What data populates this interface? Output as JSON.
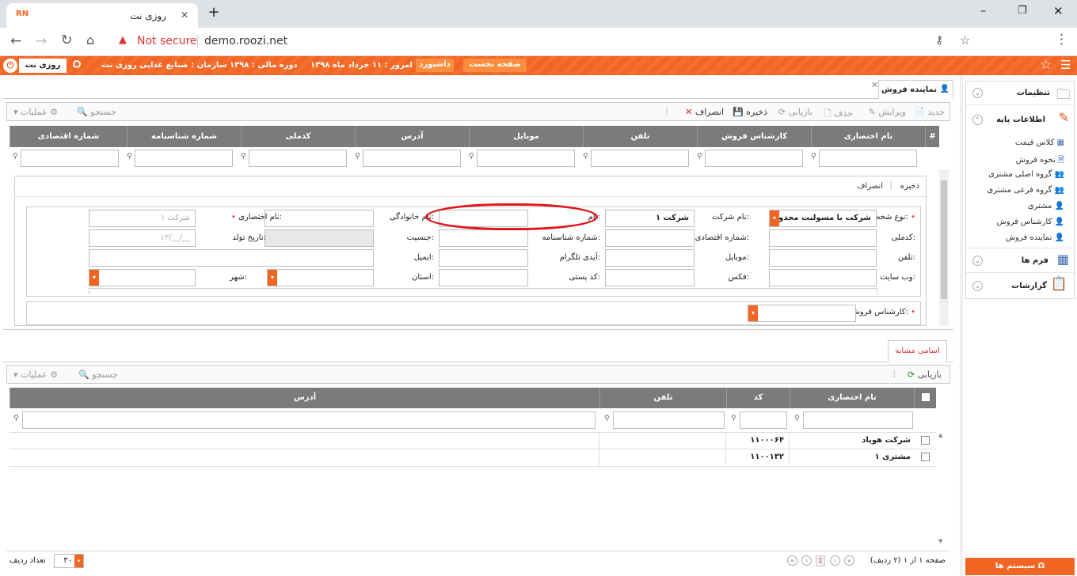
{
  "browser": {
    "tab_title": "روزی نت",
    "tab_logo": "RN",
    "new_tab": "+",
    "not_secure": "Not secure",
    "url": "demo.roozi.net",
    "window_min": "–",
    "window_max": "❐",
    "window_close": "✕"
  },
  "header": {
    "company_label": "روزی نت",
    "org": "سازمان : صنایع غذایی روزی نت",
    "fiscal": "دوره مالی : ۱۳۹۸",
    "today": "امروز : ۱۱ خرداد ماه ۱۳۹۸",
    "dashboard": "داشبورد",
    "home": "صفحه نخست"
  },
  "doc_tab": {
    "title": "نماینده فروش",
    "close": "✕"
  },
  "toolbar": {
    "new": "جدید",
    "edit": "ویرایش",
    "delete": "حذف",
    "refresh": "بازیابی",
    "save": "ذخیره",
    "cancel": "انصراف",
    "search": "جستجو",
    "operations": "عملیات"
  },
  "grid": {
    "columns": [
      "نام اختصاری",
      "کارشناس فروش",
      "تلفن",
      "موبایل",
      "آدرس",
      "کدملی",
      "شماره شناسنامه",
      "شماره اقتصادی"
    ],
    "hash": "#"
  },
  "form": {
    "save": "ذخیره",
    "cancel": "انصراف",
    "person_type_label": "نوع شخص:",
    "person_type_value": "شرکت با مسولیت محدود",
    "company_name_label": "نام شرکت:",
    "company_name_value": "شرکت ۱",
    "first_name_label": "نام:",
    "last_name_label": "نام خانوادگی:",
    "short_name_label": "نام اختصاری:",
    "short_name_placeholder": "شرکت ۱",
    "national_id_label": "کدملی:",
    "economic_no_label": "شماره اقتصادی:",
    "id_no_label": "شماره شناسنامه:",
    "gender_label": "جنسیت:",
    "birth_label": "تاریخ تولد:",
    "birth_placeholder": "__/__/۱۳",
    "phone_label": "تلفن:",
    "mobile_label": "موبایل:",
    "telegram_label": "آیدی تلگرام:",
    "email_label": "ایمیل:",
    "website_label": "وب سایت:",
    "fax_label": "فکس:",
    "postal_label": "کد پستی:",
    "province_label": "استان:",
    "city_label": "شهر:",
    "sales_expert_label": "کارشناس فروش:"
  },
  "similar": {
    "tab": "اسامی مشابه",
    "refresh": "بازیابی",
    "search": "جستجو",
    "operations": "عملیات",
    "columns": [
      "نام اختصاری",
      "کد",
      "تلفن",
      "آدرس"
    ],
    "rows": [
      {
        "name": "شرکت هویاد",
        "code": "۱۱۰۰۰۶۴",
        "phone": "",
        "address": ""
      },
      {
        "name": "مشتری ۱",
        "code": "۱۱۰۰۱۳۲",
        "phone": "",
        "address": ""
      }
    ],
    "pager_text": "صفحه ۱ از ۱ (۲ ردیف)",
    "page_no": "1",
    "rows_count_label": "تعداد ردیف",
    "rows_count_value": "۳۰"
  },
  "sidebar": {
    "settings": "تنظیمات",
    "basic_info": "اطلاعات پایه",
    "items": [
      "کلاس قیمت",
      "نحوه فروش",
      "گروه اصلی مشتری",
      "گروه فرعی مشتری",
      "مشتری",
      "کارشناس فروش",
      "نماینده فروش"
    ],
    "forms": "فرم ها",
    "reports": "گزارشات",
    "system": "سیستم ها"
  },
  "colors": {
    "accent": "#f26522",
    "grid_header": "#7b7b7b",
    "highlight": "#e0161b"
  }
}
